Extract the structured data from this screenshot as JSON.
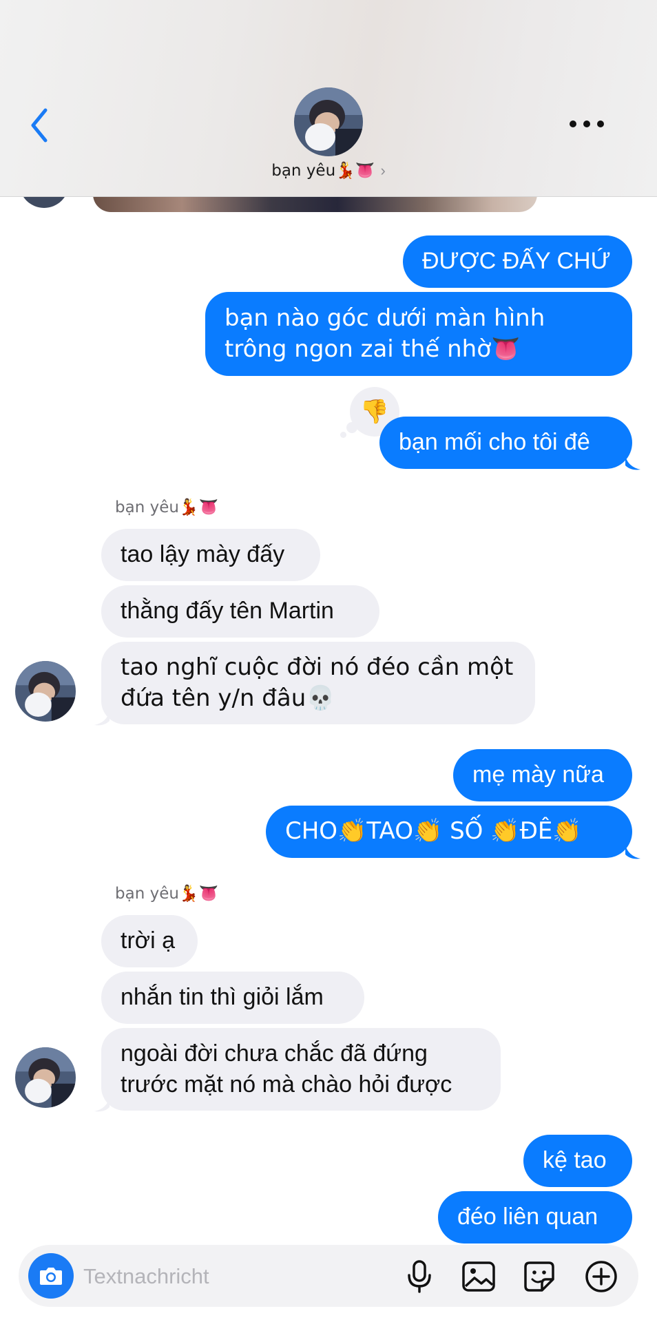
{
  "header": {
    "contact_name": "bạn yêu💃👅",
    "chevron": "›",
    "back_icon": "chevron-left-icon",
    "more_icon": "ellipsis-icon"
  },
  "colors": {
    "outgoing_bubble": "#0a7cff",
    "incoming_bubble": "#efeff4",
    "accent": "#1a7bf5"
  },
  "messages": [
    {
      "id": "m1",
      "direction": "out",
      "text": "ĐƯỢC ĐẤY CHỨ"
    },
    {
      "id": "m2",
      "direction": "out",
      "text": "bạn nào góc dưới màn hình trông ngon zai thế nhờ👅"
    },
    {
      "id": "m3",
      "direction": "out",
      "text": "bạn mối cho tôi đê",
      "reaction": "👎"
    },
    {
      "id": "s1",
      "type": "sender",
      "text": "bạn yêu💃👅"
    },
    {
      "id": "m4",
      "direction": "in",
      "text": "tao lậy mày đấy"
    },
    {
      "id": "m5",
      "direction": "in",
      "text": "thằng đấy tên Martin"
    },
    {
      "id": "m6",
      "direction": "in",
      "text": "tao nghĩ cuộc đời nó đéo cần một đứa tên y/n đâu💀"
    },
    {
      "id": "m7",
      "direction": "out",
      "text": "mẹ mày nữa"
    },
    {
      "id": "m8",
      "direction": "out",
      "text": "CHO👏TAO👏 SỐ 👏ĐÊ👏"
    },
    {
      "id": "s2",
      "type": "sender",
      "text": "bạn yêu💃👅"
    },
    {
      "id": "m9",
      "direction": "in",
      "text": "trời ạ"
    },
    {
      "id": "m10",
      "direction": "in",
      "text": "nhắn tin thì giỏi lắm"
    },
    {
      "id": "m11",
      "direction": "in",
      "text": "ngoài đời chưa chắc đã đứng trước mặt nó mà chào hỏi được"
    },
    {
      "id": "m12",
      "direction": "out",
      "text": "kệ tao"
    },
    {
      "id": "m13",
      "direction": "out",
      "text": "đéo liên quan"
    }
  ],
  "composer": {
    "placeholder": "Textnachricht",
    "value": "",
    "icons": [
      "camera-icon",
      "microphone-icon",
      "gallery-icon",
      "sticker-icon",
      "plus-icon"
    ]
  }
}
